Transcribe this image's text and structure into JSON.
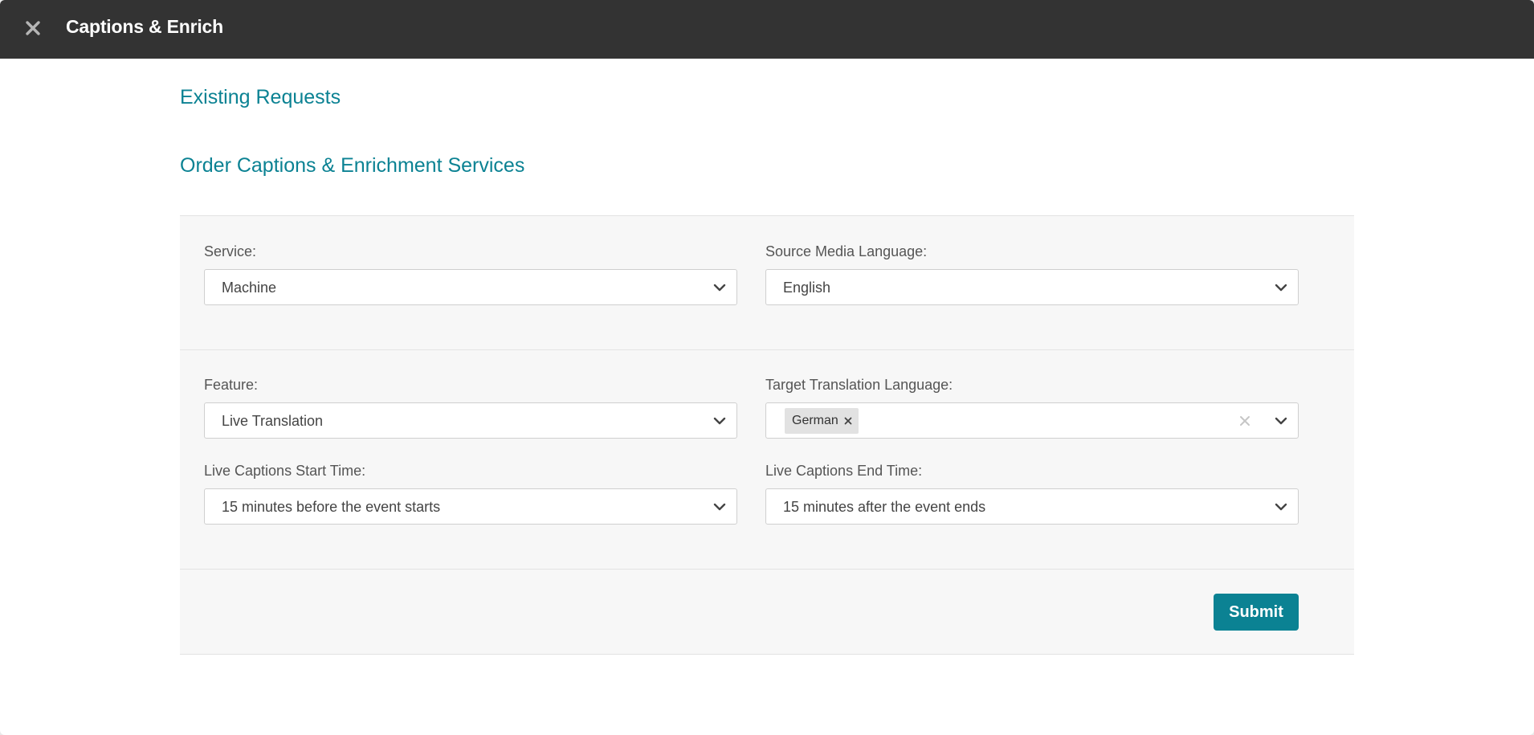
{
  "window": {
    "title": "Captions & Enrich"
  },
  "links": {
    "existing_requests": "Existing Requests",
    "order_heading": "Order Captions & Enrichment Services"
  },
  "form": {
    "service": {
      "label": "Service:",
      "value": "Machine"
    },
    "source_language": {
      "label": "Source Media Language:",
      "value": "English"
    },
    "feature": {
      "label": "Feature:",
      "value": "Live Translation"
    },
    "target_language": {
      "label": "Target Translation Language:",
      "tags": [
        "German"
      ]
    },
    "start_time": {
      "label": "Live Captions Start Time:",
      "value": "15 minutes before the event starts"
    },
    "end_time": {
      "label": "Live Captions End Time:",
      "value": "15 minutes after the event ends"
    },
    "submit_label": "Submit"
  },
  "icons": {
    "close": "close-icon",
    "chevron": "chevron-down-icon",
    "tag_remove": "tag-remove-icon",
    "clear": "clear-icon"
  },
  "colors": {
    "titlebar": "#333333",
    "accent": "#0b8293",
    "panel": "#f7f7f7"
  }
}
